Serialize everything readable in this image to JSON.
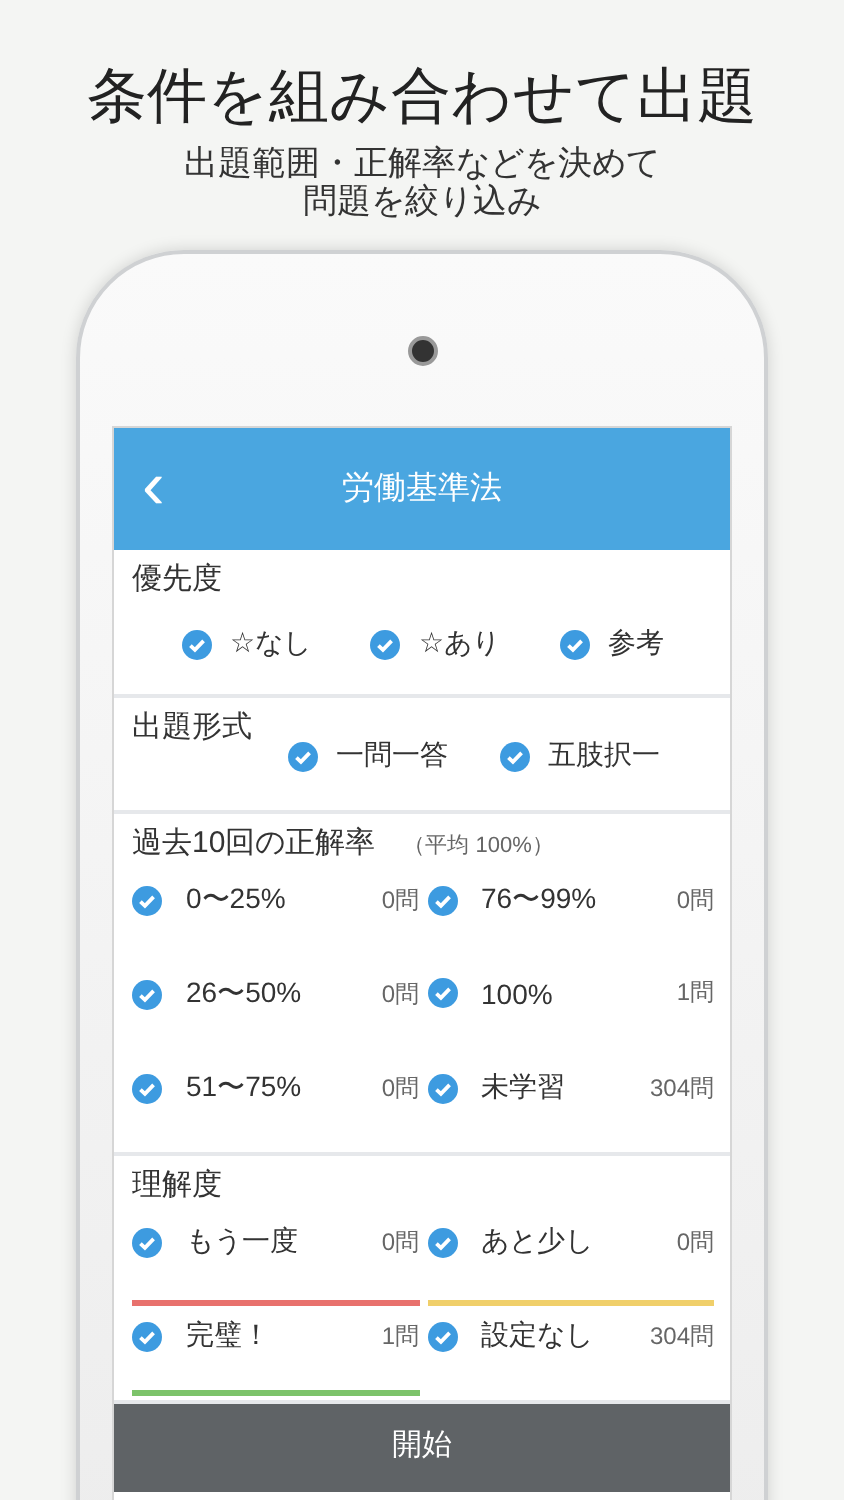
{
  "headline": "条件を組み合わせて出題",
  "subtitle": [
    "出題範囲・正解率などを決めて",
    "問題を絞り込み"
  ],
  "header": {
    "back": "‹",
    "title": "労働基準法"
  },
  "sections": [
    {
      "kind": "options",
      "title": "優先度",
      "items": [
        {
          "label": "☆なし",
          "checked": true
        },
        {
          "label": "☆あり",
          "checked": true
        },
        {
          "label": "参考",
          "checked": true
        }
      ]
    },
    {
      "kind": "inline",
      "title": "出題形式",
      "items": [
        {
          "label": "一問一答",
          "checked": true
        },
        {
          "label": "五肢択一",
          "checked": true
        }
      ]
    },
    {
      "kind": "grid",
      "title": "過去10回の正解率",
      "note": "（平均 100%）",
      "items": [
        {
          "label": "0〜25%",
          "count": "0問",
          "checked": true
        },
        {
          "label": "76〜99%",
          "count": "0問",
          "checked": true
        },
        {
          "label": "26〜50%",
          "count": "0問",
          "checked": true
        },
        {
          "label": "100%",
          "count": "1問",
          "checked": true
        },
        {
          "label": "51〜75%",
          "count": "0問",
          "checked": true
        },
        {
          "label": "未学習",
          "count": "304問",
          "checked": true
        }
      ]
    },
    {
      "kind": "grid",
      "title": "理解度",
      "items": [
        {
          "label": "もう一度",
          "count": "0問",
          "checked": true,
          "color": "#e8716d"
        },
        {
          "label": "あと少し",
          "count": "0問",
          "checked": true,
          "color": "#f0cf6a"
        },
        {
          "label": "完璧！",
          "count": "1問",
          "checked": true,
          "color": "#7cc36a"
        },
        {
          "label": "設定なし",
          "count": "304問",
          "checked": true
        }
      ]
    }
  ],
  "start_button": "開始"
}
